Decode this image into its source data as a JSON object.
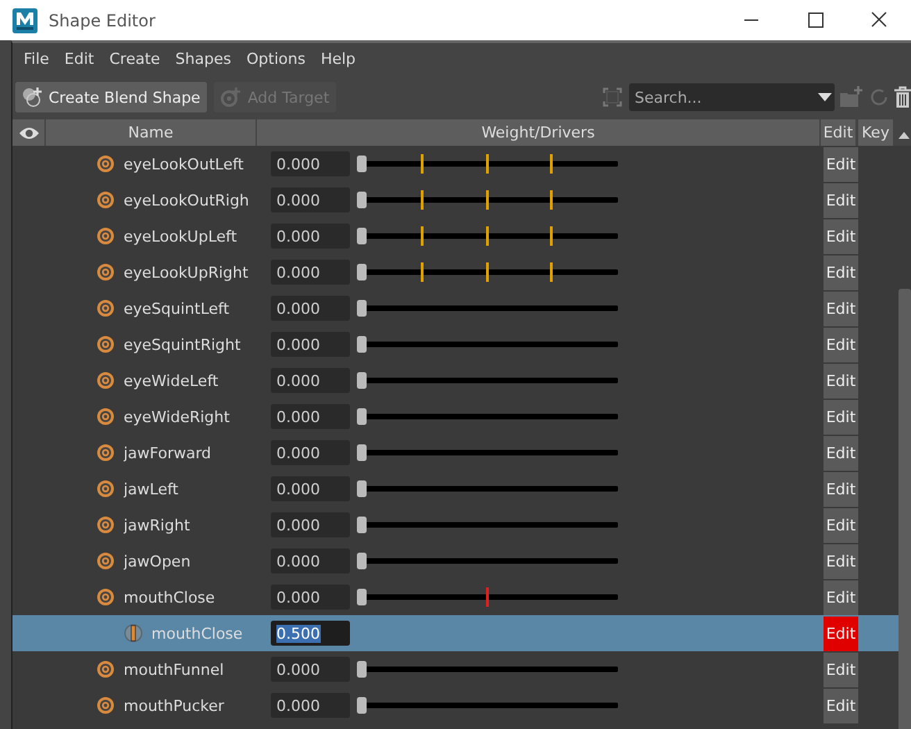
{
  "window": {
    "title": "Shape Editor"
  },
  "menu": [
    "File",
    "Edit",
    "Create",
    "Shapes",
    "Options",
    "Help"
  ],
  "toolbar": {
    "create_button": {
      "label": "Create Blend Shape",
      "disabled": false
    },
    "add_button": {
      "label": "Add Target",
      "disabled": true
    },
    "search": {
      "placeholder": "Search..."
    }
  },
  "table": {
    "columns": [
      "Name",
      "Weight/Drivers",
      "Edit",
      "Key"
    ],
    "rows": [
      {
        "kind": "target",
        "name": "eyeLookOutLeft",
        "value": "0.000",
        "level": 0,
        "selected": false,
        "edit": "Edit",
        "edit_active": false,
        "marks": [
          {
            "level": 0.24,
            "color": "#e0a000"
          },
          {
            "level": 0.49,
            "color": "#e0a000"
          },
          {
            "level": 0.74,
            "color": "#e0a000"
          }
        ]
      },
      {
        "kind": "target",
        "name": "eyeLookOutRigh",
        "value": "0.000",
        "level": 0,
        "selected": false,
        "edit": "Edit",
        "edit_active": false,
        "marks": [
          {
            "level": 0.24,
            "color": "#e0a000"
          },
          {
            "level": 0.49,
            "color": "#e0a000"
          },
          {
            "level": 0.74,
            "color": "#e0a000"
          }
        ]
      },
      {
        "kind": "target",
        "name": "eyeLookUpLeft",
        "value": "0.000",
        "level": 0,
        "selected": false,
        "edit": "Edit",
        "edit_active": false,
        "marks": [
          {
            "level": 0.24,
            "color": "#e0a000"
          },
          {
            "level": 0.49,
            "color": "#e0a000"
          },
          {
            "level": 0.74,
            "color": "#e0a000"
          }
        ]
      },
      {
        "kind": "target",
        "name": "eyeLookUpRight",
        "value": "0.000",
        "level": 0,
        "selected": false,
        "edit": "Edit",
        "edit_active": false,
        "marks": [
          {
            "level": 0.24,
            "color": "#e0a000"
          },
          {
            "level": 0.49,
            "color": "#e0a000"
          },
          {
            "level": 0.74,
            "color": "#e0a000"
          }
        ]
      },
      {
        "kind": "target",
        "name": "eyeSquintLeft",
        "value": "0.000",
        "level": 0,
        "selected": false,
        "edit": "Edit",
        "edit_active": false
      },
      {
        "kind": "target",
        "name": "eyeSquintRight",
        "value": "0.000",
        "level": 0,
        "selected": false,
        "edit": "Edit",
        "edit_active": false
      },
      {
        "kind": "target",
        "name": "eyeWideLeft",
        "value": "0.000",
        "level": 0,
        "selected": false,
        "edit": "Edit",
        "edit_active": false
      },
      {
        "kind": "target",
        "name": "eyeWideRight",
        "value": "0.000",
        "level": 0,
        "selected": false,
        "edit": "Edit",
        "edit_active": false
      },
      {
        "kind": "target",
        "name": "jawForward",
        "value": "0.000",
        "level": 0,
        "selected": false,
        "edit": "Edit",
        "edit_active": false
      },
      {
        "kind": "target",
        "name": "jawLeft",
        "value": "0.000",
        "level": 0,
        "selected": false,
        "edit": "Edit",
        "edit_active": false
      },
      {
        "kind": "target",
        "name": "jawRight",
        "value": "0.000",
        "level": 0,
        "selected": false,
        "edit": "Edit",
        "edit_active": false
      },
      {
        "kind": "target",
        "name": "jawOpen",
        "value": "0.000",
        "level": 0,
        "selected": false,
        "edit": "Edit",
        "edit_active": false
      },
      {
        "kind": "target",
        "name": "mouthClose",
        "value": "0.000",
        "level": 0,
        "selected": false,
        "edit": "Edit",
        "edit_active": false,
        "marks": [
          {
            "level": 0.49,
            "color": "#e02020"
          }
        ],
        "children": [
          {
            "kind": "inbetween",
            "name": "mouthClose",
            "value": "0.500",
            "selected": true,
            "edit": "Edit",
            "edit_active": true
          }
        ]
      },
      {
        "kind": "target",
        "name": "mouthFunnel",
        "value": "0.000",
        "level": 0,
        "selected": false,
        "edit": "Edit",
        "edit_active": false
      },
      {
        "kind": "target",
        "name": "mouthPucker",
        "value": "0.000",
        "level": 0,
        "selected": false,
        "edit": "Edit",
        "edit_active": false
      }
    ]
  }
}
